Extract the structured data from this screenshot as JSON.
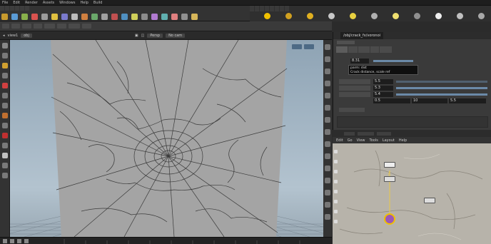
{
  "menubar": {
    "items": [
      "File",
      "Edit",
      "Render",
      "Assets",
      "Windows",
      "Help",
      "Build"
    ]
  },
  "viewport": {
    "header_label": "view1",
    "path_label": "obj",
    "chip_a": "Persp",
    "chip_b": "No cam"
  },
  "params": {
    "node_path": "/obj/crack_fx/voronoi",
    "values": [
      "8.31",
      "5.5",
      "5.3",
      "5.4",
      "0.5",
      "0.5",
      "10",
      "5.5"
    ]
  },
  "tooltip": {
    "line1": "parm: dist",
    "line2": "Crack distance, scale ref"
  },
  "network": {
    "menu": [
      "Edit",
      "Go",
      "View",
      "Tools",
      "Layout",
      "Help"
    ]
  },
  "colors": {
    "accent": "#f0c000",
    "node_selected": "#9b59b6",
    "sky_top": "#9fb3c3",
    "ground": "#7d8d99"
  }
}
